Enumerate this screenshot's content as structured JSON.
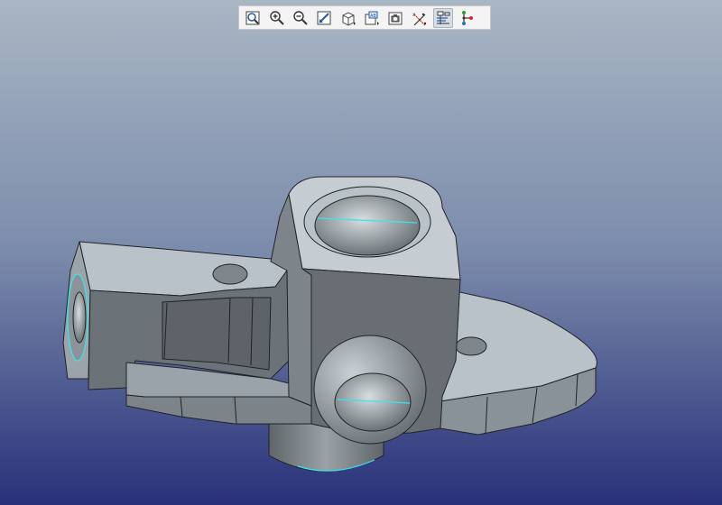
{
  "colors": {
    "bg_top": "#a9b6c4",
    "bg_mid": "#7b8bab",
    "bg_bottom": "#29307a",
    "body_light": "#b8c2c8",
    "body_mid": "#8a9299",
    "body_dark": "#5d6368",
    "highlight_edge": "#38e6ec",
    "outline": "#1f2326"
  },
  "toolbar": {
    "buttons": [
      {
        "name": "refit",
        "icon": "refit-icon",
        "active": false
      },
      {
        "name": "zoom-in",
        "icon": "zoom-in-icon",
        "active": false
      },
      {
        "name": "zoom-out",
        "icon": "zoom-out-icon",
        "active": false
      },
      {
        "name": "repaint",
        "icon": "repaint-icon",
        "active": false
      },
      {
        "name": "display-style",
        "icon": "display-style-icon",
        "active": false
      },
      {
        "name": "saved-orientations",
        "icon": "saved-orientations-icon",
        "active": false
      },
      {
        "name": "view-manager",
        "icon": "view-manager-icon",
        "active": false
      },
      {
        "name": "datum-display",
        "icon": "datum-display-icon",
        "active": false
      },
      {
        "name": "annotation-display",
        "icon": "annotation-display-icon",
        "active": true
      },
      {
        "name": "spin-center",
        "icon": "spin-center-icon",
        "active": false
      }
    ]
  },
  "model": {
    "name": "machined-part"
  }
}
